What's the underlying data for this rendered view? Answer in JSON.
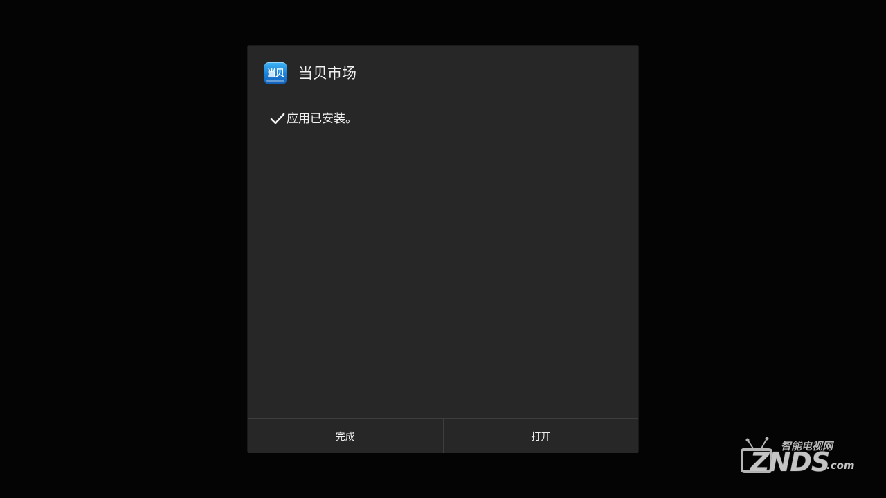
{
  "dialog": {
    "app_icon_label": "当贝",
    "app_title": "当贝市场",
    "message": "应用已安装。",
    "buttons": {
      "done_label": "完成",
      "open_label": "打开"
    }
  },
  "watermark": {
    "cn_text": "智能电视网",
    "brand": "ZNDS",
    "suffix": ".com"
  },
  "colors": {
    "dialog_bg": "#272727",
    "screen_bg": "#040404",
    "text": "#f2f2f2",
    "divider": "#3e3e3e",
    "icon_blue": "#1a7fd8"
  },
  "icons": {
    "success": "check-icon",
    "app": "dangbei-app-icon",
    "watermark_logo": "tv-icon"
  }
}
